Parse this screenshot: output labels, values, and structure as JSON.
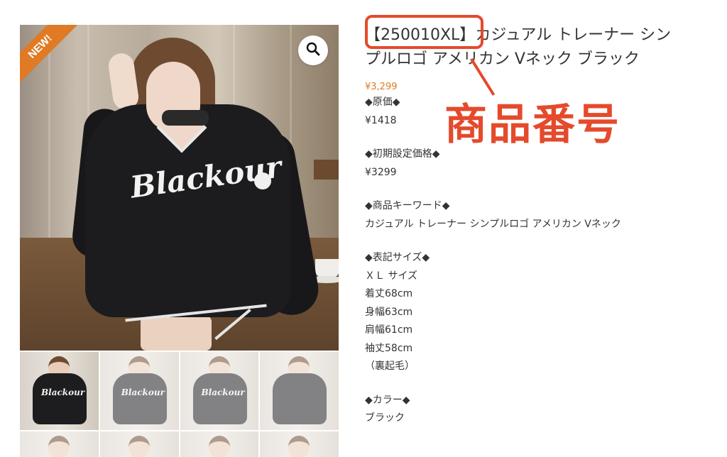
{
  "badge": {
    "label": "NEW!"
  },
  "product": {
    "sku": "【250010XL】",
    "title_rest": "カジュアル トレーナー シンプルロゴ アメリカン Vネック ブラック",
    "price": "¥3,299",
    "print_logo": "Blackour"
  },
  "annotation": {
    "label": "商品番号"
  },
  "description": {
    "cost_heading": "◆原価◆",
    "cost_value": "¥1418",
    "initial_price_heading": "◆初期設定価格◆",
    "initial_price_value": "¥3299",
    "keywords_heading": "◆商品キーワード◆",
    "keywords_value": "カジュアル トレーナー シンプルロゴ アメリカン Vネック",
    "size_heading": "◆表記サイズ◆",
    "size_label": "ＸＬ サイズ",
    "length": "着丈68cm",
    "body_width": "身幅63cm",
    "shoulder_width": "肩幅61cm",
    "sleeve_length": "袖丈58cm",
    "lining": "（裏起毛）",
    "color_heading": "◆カラー◆",
    "color_value": "ブラック"
  },
  "colors": {
    "accent_orange": "#e07a24",
    "annotation_red": "#e44a2b",
    "text": "#333333"
  },
  "icons": {
    "zoom": "magnifier-icon"
  }
}
